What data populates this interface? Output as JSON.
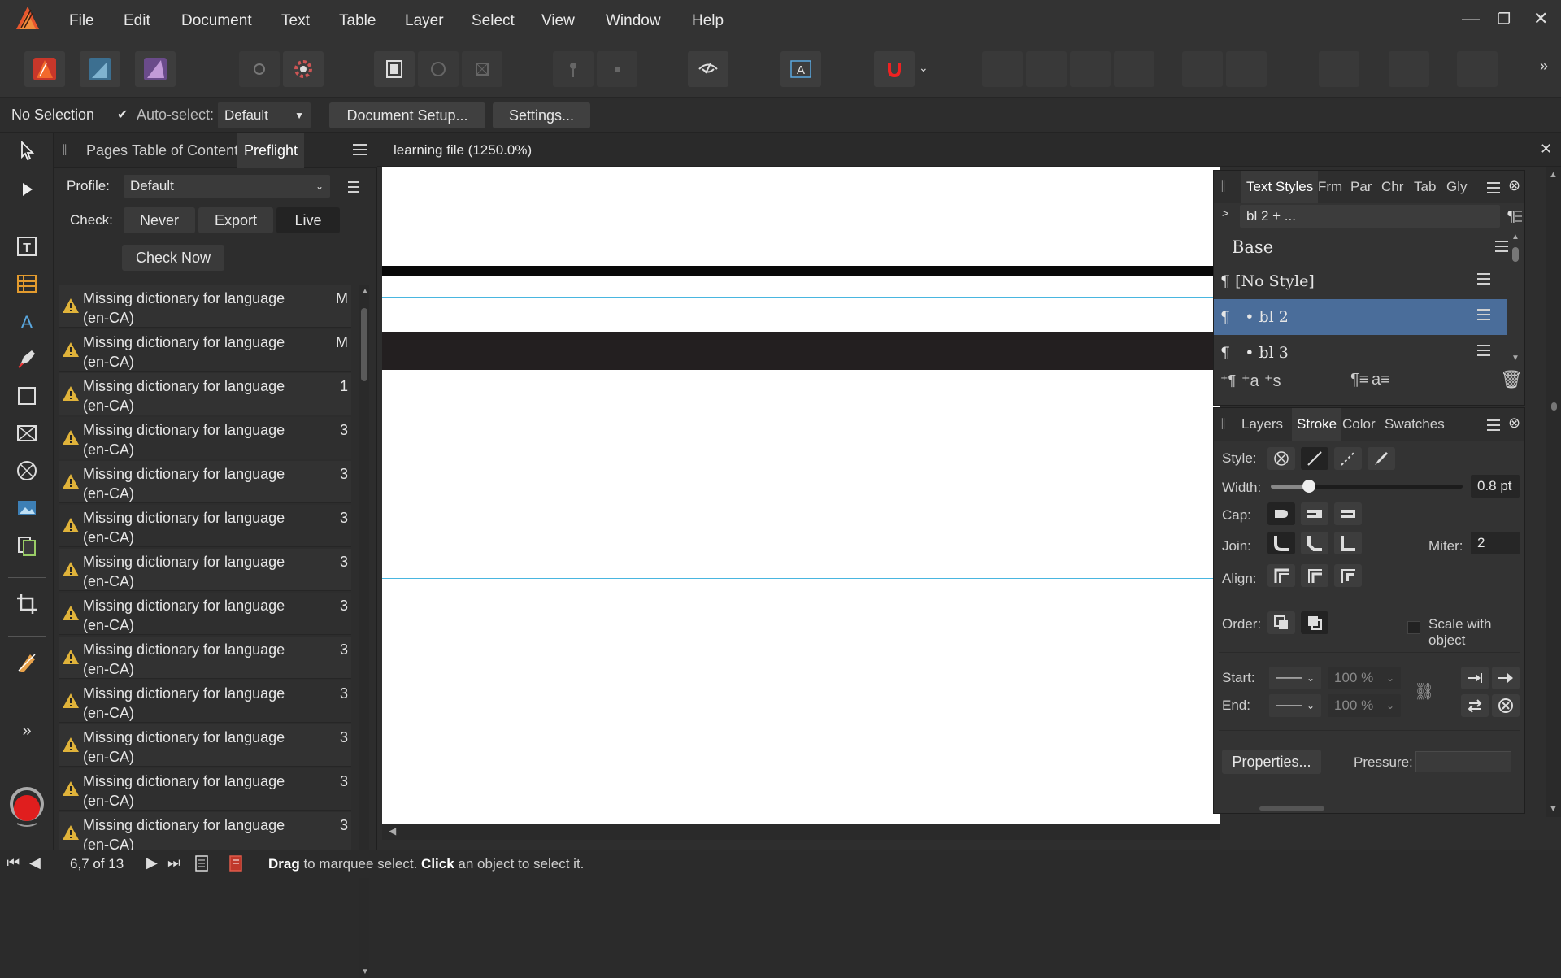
{
  "menubar": {
    "items": [
      "File",
      "Edit",
      "Document",
      "Text",
      "Table",
      "Layer",
      "Select",
      "View",
      "Window",
      "Help"
    ],
    "window_controls": {
      "minimize": "—",
      "restore": "❐",
      "close": "✕"
    }
  },
  "context": {
    "selection": "No Selection",
    "auto_select_label": "Auto-select:",
    "auto_select_checked": true,
    "auto_select_value": "Default",
    "document_setup": "Document Setup...",
    "settings": "Settings..."
  },
  "left_panel": {
    "tabs": [
      "Pages",
      "Table of Contents",
      "Preflight"
    ],
    "active_tab": "Preflight",
    "profile_label": "Profile:",
    "profile_value": "Default",
    "check_label": "Check:",
    "check_options": [
      "Never",
      "Export",
      "Live"
    ],
    "check_active": "Live",
    "check_now": "Check Now",
    "issues": [
      {
        "line1": "Missing dictionary for language",
        "line2": "(en-CA)",
        "page": "M"
      },
      {
        "line1": "Missing dictionary for language",
        "line2": "(en-CA)",
        "page": "M"
      },
      {
        "line1": "Missing dictionary for language",
        "line2": "(en-CA)",
        "page": "1"
      },
      {
        "line1": "Missing dictionary for language",
        "line2": "(en-CA)",
        "page": "3"
      },
      {
        "line1": "Missing dictionary for language",
        "line2": "(en-CA)",
        "page": "3"
      },
      {
        "line1": "Missing dictionary for language",
        "line2": "(en-CA)",
        "page": "3"
      },
      {
        "line1": "Missing dictionary for language",
        "line2": "(en-CA)",
        "page": "3"
      },
      {
        "line1": "Missing dictionary for language",
        "line2": "(en-CA)",
        "page": "3"
      },
      {
        "line1": "Missing dictionary for language",
        "line2": "(en-CA)",
        "page": "3"
      },
      {
        "line1": "Missing dictionary for language",
        "line2": "(en-CA)",
        "page": "3"
      },
      {
        "line1": "Missing dictionary for language",
        "line2": "(en-CA)",
        "page": "3"
      },
      {
        "line1": "Missing dictionary for language",
        "line2": "(en-CA)",
        "page": "3"
      },
      {
        "line1": "Missing dictionary for language",
        "line2": "(en-CA)",
        "page": "3"
      }
    ]
  },
  "document": {
    "tab_title": "learning file (1250.0%)"
  },
  "text_styles_panel": {
    "tabs": [
      "Text Styles",
      "Frm",
      "Par",
      "Chr",
      "Tab",
      "Gly"
    ],
    "active_tab": "Text Styles",
    "search_value": "bl 2 + ...",
    "group_label": "Base",
    "styles": [
      {
        "label": "¶ [No Style]",
        "selected": false
      },
      {
        "label": "¶   • bl 2",
        "selected": true
      },
      {
        "label": "¶   • bl 3",
        "selected": false
      }
    ]
  },
  "stroke_panel": {
    "tabs": [
      "Layers",
      "Stroke",
      "Color",
      "Swatches"
    ],
    "active_tab": "Stroke",
    "style_label": "Style:",
    "width_label": "Width:",
    "width_value": "0.8 pt",
    "width_fraction": 0.2,
    "cap_label": "Cap:",
    "join_label": "Join:",
    "miter_label": "Miter:",
    "miter_value": "2",
    "align_label": "Align:",
    "order_label": "Order:",
    "scale_label": "Scale with object",
    "start_label": "Start:",
    "end_label": "End:",
    "start_pct": "100 %",
    "end_pct": "100 %",
    "properties_button": "Properties...",
    "pressure_label": "Pressure:"
  },
  "status": {
    "page_indicator": "6,7 of 13",
    "hint_bold1": "Drag",
    "hint_text1": " to marquee select. ",
    "hint_bold2": "Click",
    "hint_text2": " an object to select it."
  },
  "colors": {
    "accent_selected": "#4a6d9a",
    "warning": "#e0b33a",
    "brand_red": "#e33b2e",
    "guide": "#49b6e0"
  },
  "icons": {
    "publisher": "publisher-icon",
    "designer": "designer-persona-icon",
    "photo": "photo-persona-icon"
  }
}
